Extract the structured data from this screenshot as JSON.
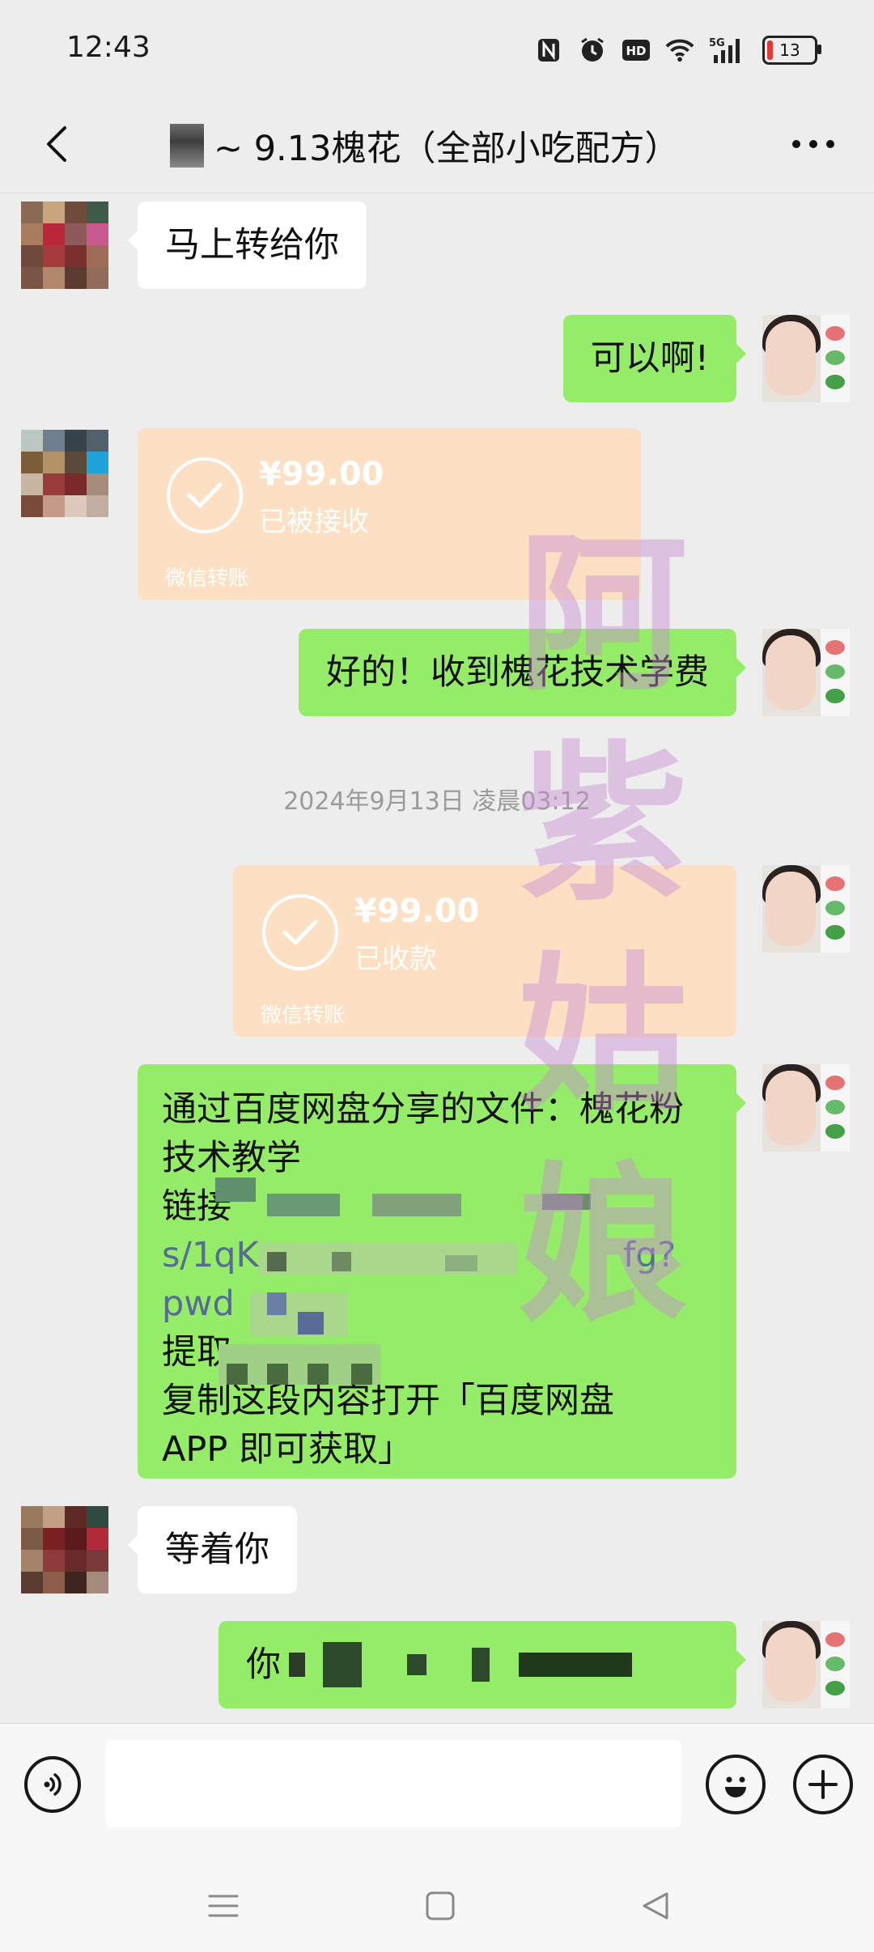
{
  "status_bar": {
    "time": "12:43",
    "battery_level": "13",
    "network": "5G",
    "icons": [
      "nfc-icon",
      "alarm-icon",
      "hd-icon",
      "wifi-icon",
      "signal-icon",
      "battery-icon"
    ]
  },
  "header": {
    "title": "~ 9.13槐花（全部小吃配方）",
    "back_icon": "chevron-left-icon",
    "more_icon": "more-dots-icon"
  },
  "messages": [
    {
      "sender": "other",
      "type": "text",
      "text": "马上转给你"
    },
    {
      "sender": "me",
      "type": "text",
      "text": "可以啊!"
    },
    {
      "sender": "other",
      "type": "transfer",
      "amount": "¥99.00",
      "status": "已被接收",
      "footer": "微信转账"
    },
    {
      "sender": "me",
      "type": "text",
      "text": "好的！收到槐花技术学费"
    },
    {
      "type": "timestamp",
      "text": "2024年9月13日 凌晨03:12"
    },
    {
      "sender": "me",
      "type": "transfer",
      "amount": "¥99.00",
      "status": "已收款",
      "footer": "微信转账"
    },
    {
      "sender": "me",
      "type": "share",
      "lines": [
        "通过百度网盘分享的文件：槐花粉",
        "技术教学",
        "链接",
        "s/1qK",
        "fg?",
        "pwd",
        "提取",
        "复制这段内容打开「百度网盘",
        "APP 即可获取」"
      ]
    },
    {
      "sender": "other",
      "type": "text",
      "text": "等着你"
    },
    {
      "sender": "me",
      "type": "text",
      "text": "你"
    }
  ],
  "watermark": [
    "阿",
    "紫",
    "姑",
    "娘"
  ],
  "input_bar": {
    "voice_icon": "voice-icon",
    "emoji_icon": "emoji-icon",
    "plus_icon": "plus-icon",
    "placeholder": ""
  },
  "nav_bar": {
    "icons": [
      "menu-icon",
      "home-icon",
      "back-triangle-icon"
    ]
  },
  "colors": {
    "bubble_green": "#95ec69",
    "bubble_white": "#ffffff",
    "transfer_orange": "#fde0c3",
    "link_blue": "#576b95",
    "background": "#ededed"
  }
}
